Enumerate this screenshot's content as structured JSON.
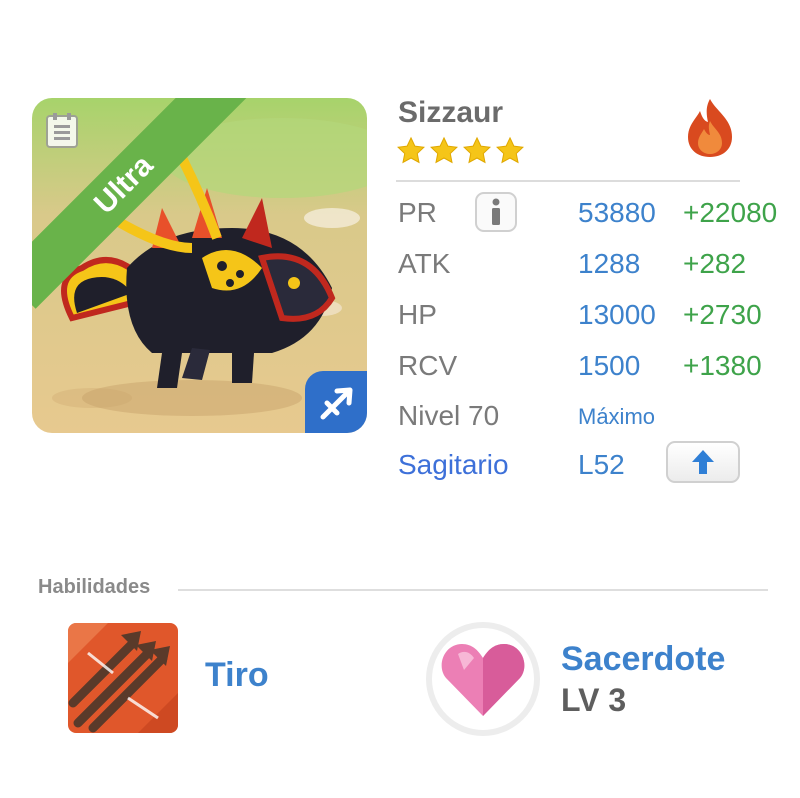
{
  "monster": {
    "name": "Sizzaur",
    "rarity": "Ultra",
    "stars": 4,
    "element": "fire-icon",
    "zodiac_badge": "sagittarius-arrow-icon"
  },
  "stats": {
    "pr": {
      "label": "PR",
      "value": "53880",
      "bonus": "+22080"
    },
    "atk": {
      "label": "ATK",
      "value": "1288",
      "bonus": "+282"
    },
    "hp": {
      "label": "HP",
      "value": "13000",
      "bonus": "+2730"
    },
    "rcv": {
      "label": "RCV",
      "value": "1500",
      "bonus": "+1380"
    },
    "level": {
      "label": "Nivel 70",
      "value": "Máximo"
    },
    "zodiac": {
      "label": "Sagitario",
      "value": "L52"
    }
  },
  "skills": {
    "title": "Habilidades",
    "skill": {
      "name": "Tiro",
      "icon": "arrows-icon"
    },
    "class": {
      "name": "Sacerdote",
      "level": "LV 3",
      "icon": "heart-icon"
    }
  },
  "colors": {
    "ribbon": "#69b34a",
    "value_blue": "#3d82cc",
    "bonus_green": "#3ea34a",
    "star_gold": "#f5c518",
    "element_badge": "#2f6fc9"
  }
}
